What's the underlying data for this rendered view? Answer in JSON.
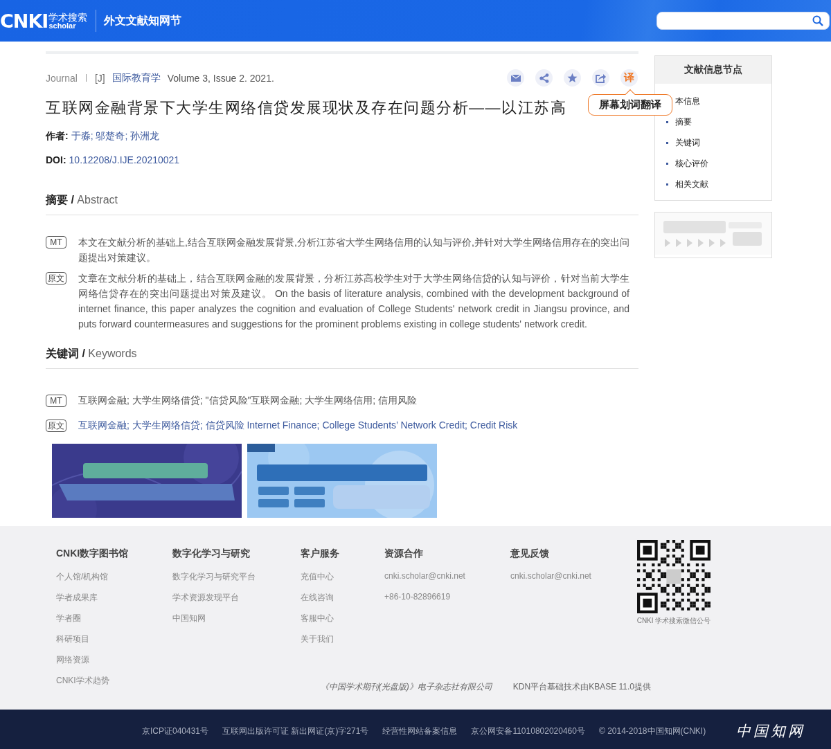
{
  "header": {
    "logo": {
      "mark": "CNKI",
      "cn": "学术搜索",
      "en": "scholar"
    },
    "site_title": "外文文献知网节"
  },
  "article": {
    "type": "Journal",
    "code": "[J]",
    "journal": "国际教育学",
    "volume": "Volume 3, Issue 2. 2021.",
    "actions": [
      {
        "kind": "mail"
      },
      {
        "kind": "share"
      },
      {
        "kind": "star"
      },
      {
        "kind": "export"
      },
      {
        "kind": "translate",
        "label": "译",
        "tooltip": "屏幕划词翻译"
      }
    ],
    "title": "互联网金融背景下大学生网络信贷发展现状及存在问题分析——以江苏高",
    "authors_label": "作者:",
    "authors": "于淼; 邬楚奇; 孙洲龙",
    "doi_label": "DOI:",
    "doi": "10.12208/J.IJE.20210021"
  },
  "abstract": {
    "heading": "**摘要 /** Abstract",
    "entries": [
      {
        "tag": "MT",
        "text": "本文在文献分析的基础上,结合互联网金融发展背景,分析江苏省大学生网络信用的认知与评价,并针对大学生网络信用存在的突出问题提出对策建议。"
      },
      {
        "tag": "原文",
        "text": "文章在文献分析的基础上，结合互联网金融的发展背景，分析江苏高校学生对于大学生网络信贷的认知与评价，针对当前大学生网络信贷存在的突出问题提出对策及建议。 On the basis of literature analysis, combined with the development background of internet finance, this paper analyzes the cognition and evaluation of College Students' network credit in Jiangsu province, and puts forward countermeasures and suggestions for the prominent problems existing in college students' network credit."
      }
    ]
  },
  "keywords": {
    "heading": "**关键词 /** Keywords",
    "entries": [
      {
        "tag": "MT",
        "text": "互联网金融; 大学生网络借贷; \"信贷风险\"互联网金融; 大学生网络信用; 信用风险",
        "linked": false
      },
      {
        "tag": "原文",
        "text": "互联网金融; 大学生网络信贷; 信贷风险 Internet Finance; College Students’ Network Credit; Credit Risk",
        "linked": true
      }
    ]
  },
  "banners": [
    {
      "kind": "picture"
    },
    {
      "kind": "picture"
    }
  ],
  "sidebar": {
    "title": "文献信息节点",
    "items": [
      "本信息",
      "摘要",
      "关键词",
      "核心评价",
      "相关文献"
    ],
    "promo": {
      "kind": "picture"
    }
  },
  "footer": {
    "columns": [
      {
        "heading": "CNKI数字图书馆",
        "items": [
          "个人馆/机构馆",
          "学者成果库",
          "学者圈",
          "科研项目",
          "网络资源",
          "CNKI学术趋势"
        ]
      },
      {
        "heading": "数字化学习与研究",
        "items": [
          "数字化学习与研究平台",
          "学术资源发现平台",
          "中国知网"
        ]
      },
      {
        "heading": "客户服务",
        "items": [
          "充值中心",
          "在线咨询",
          "客服中心",
          "关于我们"
        ]
      },
      {
        "heading": "资源合作",
        "items": [
          "cnki.scholar@cnki.net",
          "+86-10-82896619"
        ]
      },
      {
        "heading": "意见反馈",
        "items": [
          "cnki.scholar@cnki.net"
        ]
      }
    ],
    "qr_caption": "CNKI 学术搜索微信公号",
    "credits": [
      {
        "text": "《中国学术期刊(光盘版)》电子杂志社有限公司",
        "italic": true
      },
      {
        "text": "KDN平台基础技术由KBASE 11.0提供",
        "italic": false
      }
    ]
  },
  "bottom_bar": {
    "items": [
      "京ICP证040431号",
      "互联网出版许可证 新出网证(京)字271号",
      "经营性网站备案信息",
      "京公网安备11010802020460号",
      "© 2014-2018中国知网(CNKI)"
    ],
    "logo": "中国知网"
  }
}
